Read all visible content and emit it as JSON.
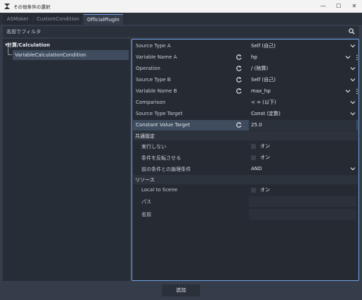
{
  "window": {
    "title": "その他条件の選択",
    "minimize_glyph": "—",
    "maximize_glyph": "☐",
    "close_glyph": "✕"
  },
  "tabs": [
    {
      "label": "ASMaker",
      "active": false
    },
    {
      "label": "CustomCondition",
      "active": false
    },
    {
      "label": "OfficialPlugin",
      "active": true
    }
  ],
  "filter": {
    "placeholder": "名前でフィルタ",
    "icon": "search-icon"
  },
  "tree": {
    "category": "計算/Calculation",
    "selected_item": "VariableCalculationCondition"
  },
  "inspector": {
    "rows": [
      {
        "label": "Source Type A",
        "value": "Self (自己)",
        "reset": false,
        "dropdown": true
      },
      {
        "label": "Variable Name A",
        "value": "hp",
        "reset": true,
        "dropdown": true,
        "drag": true
      },
      {
        "label": "Operation",
        "value": "/ (除算)",
        "reset": true,
        "dropdown": true
      },
      {
        "label": "Source Type B",
        "value": "Self (自己)",
        "reset": true,
        "dropdown": true
      },
      {
        "label": "Variable Name B",
        "value": "max_hp",
        "reset": true,
        "dropdown": true,
        "drag": true
      },
      {
        "label": "Comparison",
        "value": "< = (以下)",
        "reset": false,
        "dropdown": true
      },
      {
        "label": "Source Type Target",
        "value": "Const (定数)",
        "reset": false,
        "dropdown": true
      },
      {
        "label": "Constant Value Target",
        "value": "25.0",
        "reset": true,
        "dropdown": false
      }
    ],
    "common_section": {
      "title": "共通設定",
      "rows": [
        {
          "label": "実行しない",
          "checkbox_label": "オン"
        },
        {
          "label": "条件を反転させる",
          "checkbox_label": "オン"
        },
        {
          "label": "前の条件との論理条件",
          "value": "AND"
        }
      ]
    },
    "resource_section": {
      "title": "リソース",
      "rows": [
        {
          "label": "Local to Scene",
          "checkbox_label": "オン"
        },
        {
          "label": "パス",
          "value": ""
        },
        {
          "label": "名前",
          "value": ""
        }
      ]
    }
  },
  "footer": {
    "add_label": "追加"
  },
  "colors": {
    "accent": "#6fa3e6",
    "background": "#363d4a",
    "panel": "#262b33"
  }
}
